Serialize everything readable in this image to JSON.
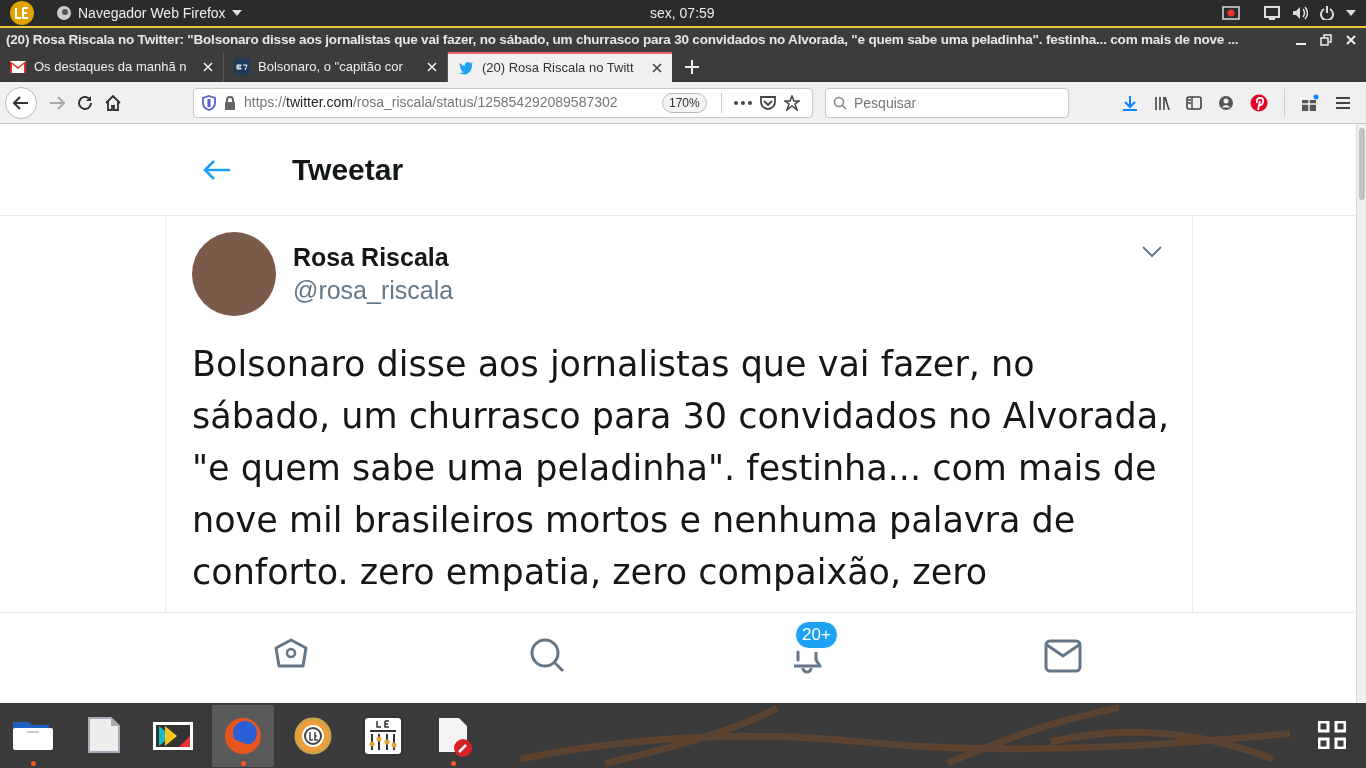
{
  "top_panel": {
    "app_menu": "Navegador Web Firefox",
    "clock": "sex, 07:59"
  },
  "window": {
    "title": "(20) Rosa Riscala no Twitter: \"Bolsonaro disse aos jornalistas que vai fazer, no sábado, um churrasco para 30 convidados no Alvorada, \"e quem sabe uma peladinha\". festinha... com mais de nove ..."
  },
  "tabs": [
    {
      "label": "Os destaques da manhã n",
      "kind": "mail",
      "selected": false
    },
    {
      "label": "Bolsonaro, o \"capitão cor",
      "kind": "news",
      "selected": false
    },
    {
      "label": "(20) Rosa Riscala no Twitt",
      "kind": "bird",
      "selected": true
    }
  ],
  "url_bar": {
    "prefix": "https://",
    "domain": "twitter.com",
    "path": "/rosa_riscala/status/125854292089587302",
    "zoom": "170%"
  },
  "search": {
    "placeholder": "Pesquisar"
  },
  "page": {
    "header": "Tweetar",
    "tweet": {
      "name": "Rosa Riscala",
      "handle": "@rosa_riscala",
      "text": "Bolsonaro disse aos jornalistas que vai fazer, no sábado, um churrasco para 30 convidados no Alvorada, \"e quem sabe uma peladinha\". festinha... com mais de nove mil brasileiros mortos e nenhuma palavra de conforto. zero empatia, zero compaixão, zero"
    },
    "bottom_nav": [
      {
        "kind": "home"
      },
      {
        "kind": "search"
      },
      {
        "kind": "bell",
        "badge": "20+"
      },
      {
        "kind": "mail"
      }
    ]
  },
  "taskbar": [
    {
      "kind": "files",
      "running": true,
      "selected": false
    },
    {
      "kind": "document",
      "running": false,
      "selected": false
    },
    {
      "kind": "store",
      "running": false,
      "selected": false
    },
    {
      "kind": "browser",
      "running": true,
      "selected": true
    },
    {
      "kind": "help",
      "running": false,
      "selected": false
    },
    {
      "kind": "mixer",
      "running": false,
      "selected": false
    },
    {
      "kind": "editor",
      "running": true,
      "selected": false
    }
  ]
}
